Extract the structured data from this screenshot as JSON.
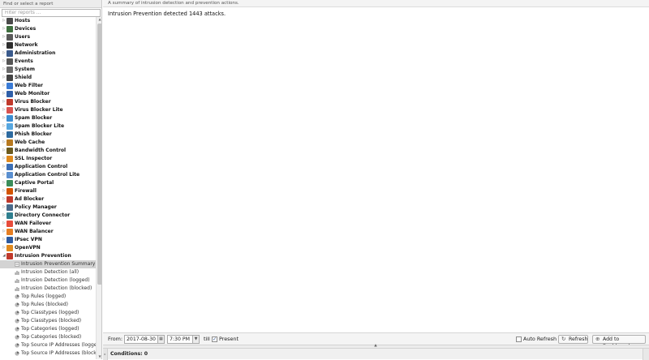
{
  "left_panel": {
    "header": "Find or select a report",
    "filter_placeholder": "Filter reports ..."
  },
  "tree": {
    "groups": [
      {
        "label": "Hosts",
        "color": "#4a4a4a"
      },
      {
        "label": "Devices",
        "color": "#3f6f3f"
      },
      {
        "label": "Users",
        "color": "#5a5a5a"
      },
      {
        "label": "Network",
        "color": "#2e2e2e"
      },
      {
        "label": "Administration",
        "color": "#3a5a8c"
      },
      {
        "label": "Events",
        "color": "#555555"
      },
      {
        "label": "System",
        "color": "#6a6a6a"
      },
      {
        "label": "Shield",
        "color": "#444444"
      },
      {
        "label": "Web Filter",
        "color": "#3a7bd5"
      },
      {
        "label": "Web Monitor",
        "color": "#2f5fa8"
      },
      {
        "label": "Virus Blocker",
        "color": "#c0392b"
      },
      {
        "label": "Virus Blocker Lite",
        "color": "#d9534f"
      },
      {
        "label": "Spam Blocker",
        "color": "#3d8ed1"
      },
      {
        "label": "Spam Blocker Lite",
        "color": "#57a7e0"
      },
      {
        "label": "Phish Blocker",
        "color": "#2d6a9f"
      },
      {
        "label": "Web Cache",
        "color": "#b7791f"
      },
      {
        "label": "Bandwidth Control",
        "color": "#6b5a1e"
      },
      {
        "label": "SSL Inspector",
        "color": "#e08a1e"
      },
      {
        "label": "Application Control",
        "color": "#3c6fb5"
      },
      {
        "label": "Application Control Lite",
        "color": "#5a8fd0"
      },
      {
        "label": "Captive Portal",
        "color": "#3a8d5a"
      },
      {
        "label": "Firewall",
        "color": "#d35400"
      },
      {
        "label": "Ad Blocker",
        "color": "#c0392b"
      },
      {
        "label": "Policy Manager",
        "color": "#4a6a8a"
      },
      {
        "label": "Directory Connector",
        "color": "#2f7f8f"
      },
      {
        "label": "WAN Failover",
        "color": "#e74c3c"
      },
      {
        "label": "WAN Balancer",
        "color": "#e67e22"
      },
      {
        "label": "IPsec VPN",
        "color": "#2c5aa0"
      },
      {
        "label": "OpenVPN",
        "color": "#e08a1e"
      },
      {
        "label": "Intrusion Prevention",
        "color": "#c0392b"
      }
    ],
    "reports": [
      {
        "label": "Intrusion Prevention Summary",
        "icon": "summary-icon",
        "selected": true
      },
      {
        "label": "Intrusion Detection (all)",
        "icon": "bar-chart-icon"
      },
      {
        "label": "Intrusion Detection (logged)",
        "icon": "bar-chart-icon"
      },
      {
        "label": "Intrusion Detection (blocked)",
        "icon": "bar-chart-icon"
      },
      {
        "label": "Top Rules (logged)",
        "icon": "pie-chart-icon"
      },
      {
        "label": "Top Rules (blocked)",
        "icon": "pie-chart-icon"
      },
      {
        "label": "Top Classtypes (logged)",
        "icon": "pie-chart-icon"
      },
      {
        "label": "Top Classtypes (blocked)",
        "icon": "pie-chart-icon"
      },
      {
        "label": "Top Categories (logged)",
        "icon": "pie-chart-icon"
      },
      {
        "label": "Top Categories (blocked)",
        "icon": "pie-chart-icon"
      },
      {
        "label": "Top Source IP Addresses (logged)",
        "icon": "pie-chart-icon"
      },
      {
        "label": "Top Source IP Addresses (blocked)",
        "icon": "pie-chart-icon"
      }
    ]
  },
  "main": {
    "description": "A summary of intrusion detection and prevention actions.",
    "summary_text": "Intrusion Prevention detected 1443 attacks."
  },
  "toolbar": {
    "from_label": "From:",
    "date_value": "2017-08-30",
    "time_value": "7:30 PM",
    "till_label": "till",
    "present_label": "Present",
    "present_checked": true,
    "auto_refresh_label": "Auto Refresh",
    "auto_refresh_checked": false,
    "refresh_label": "Refresh",
    "dashboard_label": "Add to Dashboard"
  },
  "conditions": {
    "label": "Conditions: 0"
  }
}
